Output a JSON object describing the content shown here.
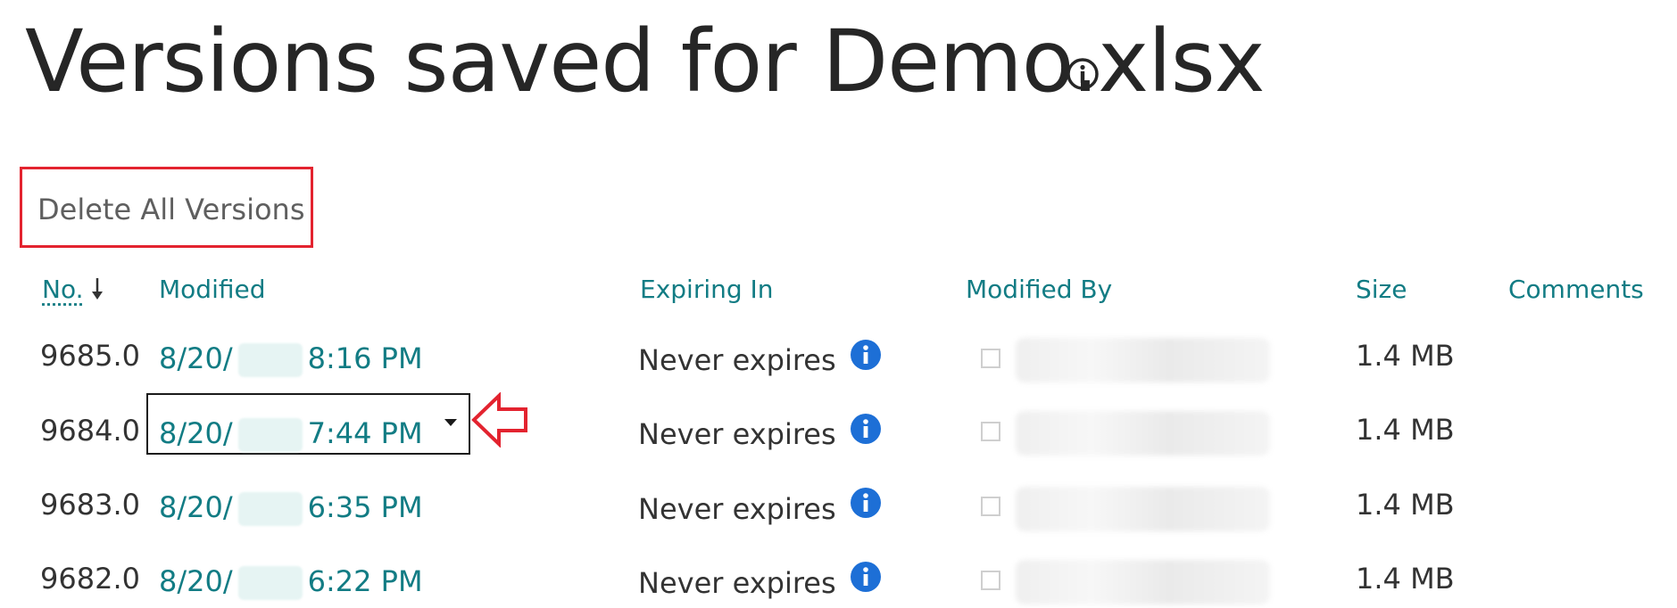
{
  "page": {
    "title": "Versions saved for Demo.xlsx",
    "title_icon": "info-circle-icon"
  },
  "toolbar": {
    "delete_all_label": "Delete All Versions"
  },
  "columns": {
    "no": "No.",
    "modified": "Modified",
    "expiring_in": "Expiring In",
    "modified_by": "Modified By",
    "size": "Size",
    "comments": "Comments"
  },
  "sort": {
    "column": "No.",
    "direction": "descending",
    "icon": "arrow-down-icon"
  },
  "rows": [
    {
      "no": "9685.0",
      "date": "8/20/",
      "time": "8:16 PM",
      "expiring": "Never expires",
      "size": "1.4 MB"
    },
    {
      "no": "9684.0",
      "date": "8/20/",
      "time": "7:44 PM",
      "expiring": "Never expires",
      "size": "1.4 MB"
    },
    {
      "no": "9683.0",
      "date": "8/20/",
      "time": "6:35 PM",
      "expiring": "Never expires",
      "size": "1.4 MB"
    },
    {
      "no": "9682.0",
      "date": "8/20/",
      "time": "6:22 PM",
      "expiring": "Never expires",
      "size": "1.4 MB"
    }
  ],
  "colors": {
    "link": "#127c84",
    "highlight_border": "#e3232f",
    "info_icon": "#1d6fd6"
  }
}
